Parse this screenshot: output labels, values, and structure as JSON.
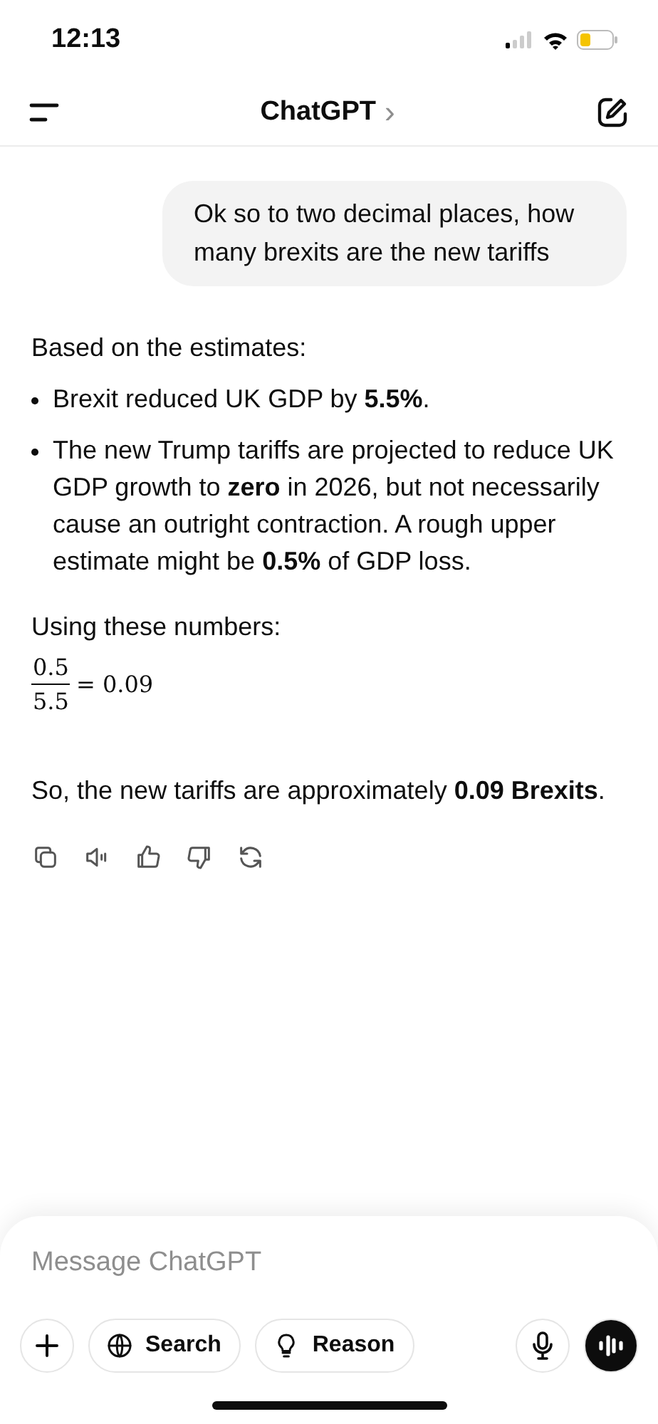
{
  "status_bar": {
    "time": "12:13"
  },
  "header": {
    "title": "ChatGPT",
    "chevron": "›"
  },
  "user_message": "Ok so to two decimal places, how many brexits are the new tariffs",
  "assistant": {
    "intro": "Based on the estimates:",
    "bullets": [
      "Brexit reduced UK GDP by **5.5%**.",
      "The new Trump tariffs are projected to reduce UK GDP growth to **zero** in 2026, but not necessarily cause an outright contraction. A rough upper estimate might be **0.5%** of GDP loss."
    ],
    "lead": "Using these numbers:",
    "formula": {
      "numerator": "0.5",
      "denominator": "5.5",
      "result": "= 0.09"
    },
    "conclusion": "So, the new tariffs are approximately **0.09 Brexits**."
  },
  "composer": {
    "placeholder": "Message ChatGPT",
    "chips": [
      "Search",
      "Reason"
    ]
  }
}
